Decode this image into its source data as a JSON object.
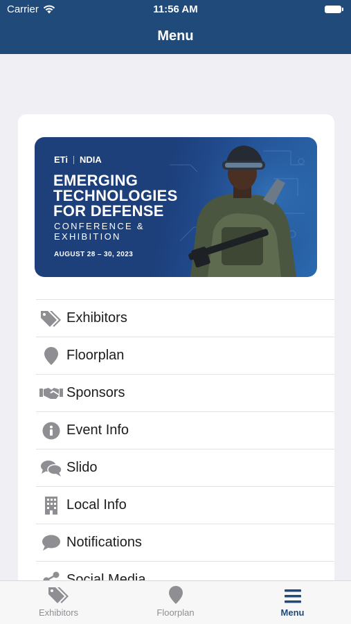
{
  "status": {
    "carrier": "Carrier",
    "time": "11:56 AM"
  },
  "nav": {
    "title": "Menu"
  },
  "banner": {
    "logo_left": "ETi",
    "logo_right": "NDIA",
    "title_lines": "EMERGING TECHNOLOGIES FOR DEFENSE",
    "line1": "EMERGING",
    "line2": "TECHNOLOGIES",
    "line3": "FOR DEFENSE",
    "subtitle1": "CONFERENCE &",
    "subtitle2": "EXHIBITION",
    "dates": "AUGUST 28 – 30, 2023"
  },
  "menu": {
    "items": [
      {
        "label": "Exhibitors",
        "icon": "tags-icon"
      },
      {
        "label": "Floorplan",
        "icon": "map-pin-icon"
      },
      {
        "label": "Sponsors",
        "icon": "handshake-icon"
      },
      {
        "label": "Event Info",
        "icon": "info-icon"
      },
      {
        "label": "Slido",
        "icon": "chat-bubbles-icon"
      },
      {
        "label": "Local Info",
        "icon": "building-icon"
      },
      {
        "label": "Notifications",
        "icon": "comment-icon"
      },
      {
        "label": "Social Media",
        "icon": "share-icon"
      }
    ]
  },
  "tabs": [
    {
      "label": "Exhibitors",
      "icon": "tags-icon",
      "active": false
    },
    {
      "label": "Floorplan",
      "icon": "map-pin-icon",
      "active": false
    },
    {
      "label": "Menu",
      "icon": "hamburger-icon",
      "active": true
    }
  ],
  "colors": {
    "navbar": "#1f4a7a",
    "icon_gray": "#8e8e93",
    "active_tab": "#1f4a7a"
  }
}
